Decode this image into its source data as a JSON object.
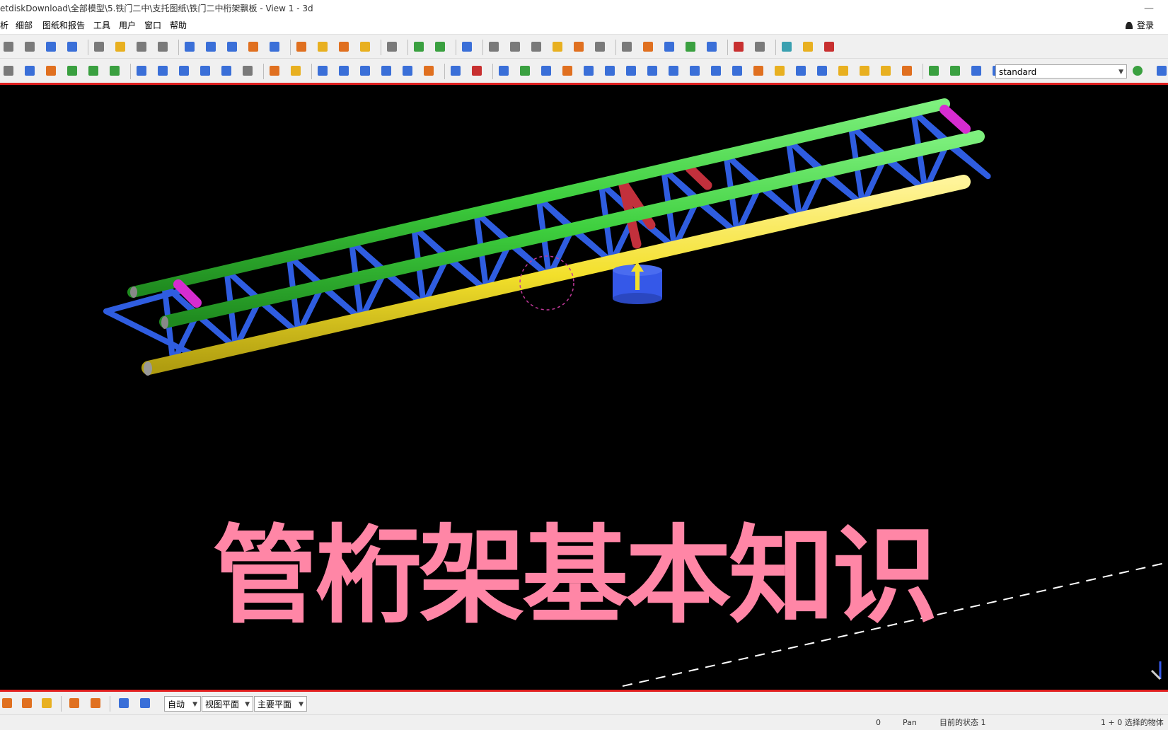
{
  "window": {
    "title": "etdiskDownload\\全部模型\\5.铁门二中\\支托图纸\\铁门二中桁架飘板  - View 1 - 3d",
    "minimize_glyph": "—"
  },
  "menu": {
    "items": [
      "析",
      "细部",
      "图纸和报告",
      "工具",
      "用户",
      "窗口",
      "帮助"
    ],
    "login_label": "登录"
  },
  "toolbar": {
    "profile_value": "standard"
  },
  "viewport": {
    "caption": "管桁架基本知识",
    "colors": {
      "chord_green": "#3ecf3e",
      "chord_yellow": "#f3e02b",
      "web_blue": "#2f5de0",
      "web_red": "#c2303c",
      "end_magenta": "#d62cd0",
      "support_blue": "#3558e8",
      "caption_pink": "#ff86a6",
      "background": "#000000"
    }
  },
  "snap_bar": {
    "mode": "自动",
    "plane": "视图平面",
    "main_plane": "主要平面"
  },
  "status": {
    "count": "0",
    "command": "Pan",
    "current_state": "目前的状态 1",
    "selected": "1 + 0 选择的物体"
  }
}
